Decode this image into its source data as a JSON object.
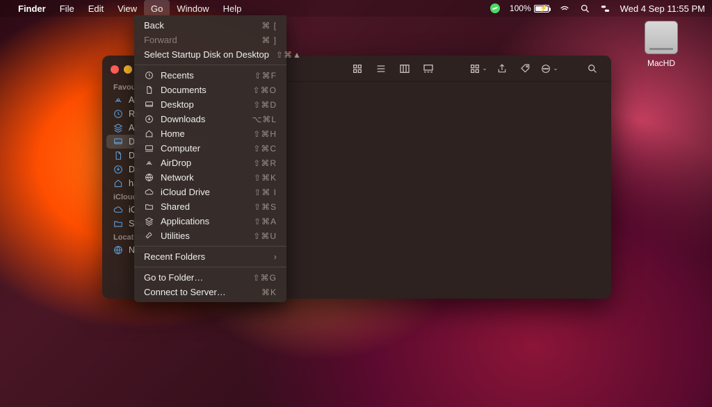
{
  "menubar": {
    "app": "Finder",
    "items": [
      "File",
      "Edit",
      "View",
      "Go",
      "Window",
      "Help"
    ],
    "battery": "100%",
    "clock": "Wed 4 Sep  11:55 PM"
  },
  "desktop_icon": {
    "label": "MacHD"
  },
  "sidebar": {
    "sections": [
      {
        "title": "Favourites",
        "items": [
          "AirDrop",
          "Recents",
          "Applications",
          "Desktop",
          "Documents",
          "Downloads",
          "hamza"
        ]
      },
      {
        "title": "iCloud",
        "items": [
          "iCloud Drive",
          "Shared"
        ]
      },
      {
        "title": "Locations",
        "items": [
          "Network"
        ]
      }
    ]
  },
  "go_menu": {
    "back": {
      "label": "Back",
      "shortcut": "⌘ ["
    },
    "forward": {
      "label": "Forward",
      "shortcut": "⌘ ]"
    },
    "startup": {
      "label": "Select Startup Disk on Desktop",
      "shortcut": "⇧⌘▲"
    },
    "places": [
      {
        "label": "Recents",
        "shortcut": "⇧⌘F",
        "icon": "clock"
      },
      {
        "label": "Documents",
        "shortcut": "⇧⌘O",
        "icon": "doc"
      },
      {
        "label": "Desktop",
        "shortcut": "⇧⌘D",
        "icon": "desktop"
      },
      {
        "label": "Downloads",
        "shortcut": "⌥⌘L",
        "icon": "download"
      },
      {
        "label": "Home",
        "shortcut": "⇧⌘H",
        "icon": "home"
      },
      {
        "label": "Computer",
        "shortcut": "⇧⌘C",
        "icon": "computer"
      },
      {
        "label": "AirDrop",
        "shortcut": "⇧⌘R",
        "icon": "airdrop"
      },
      {
        "label": "Network",
        "shortcut": "⇧⌘K",
        "icon": "globe"
      },
      {
        "label": "iCloud Drive",
        "shortcut": "⇧⌘ I",
        "icon": "cloud"
      },
      {
        "label": "Shared",
        "shortcut": "⇧⌘S",
        "icon": "folder"
      },
      {
        "label": "Applications",
        "shortcut": "⇧⌘A",
        "icon": "apps"
      },
      {
        "label": "Utilities",
        "shortcut": "⇧⌘U",
        "icon": "utilities"
      }
    ],
    "recent_folders": "Recent Folders",
    "goto": {
      "label": "Go to Folder…",
      "shortcut": "⇧⌘G"
    },
    "connect": {
      "label": "Connect to Server…",
      "shortcut": "⌘K"
    }
  }
}
